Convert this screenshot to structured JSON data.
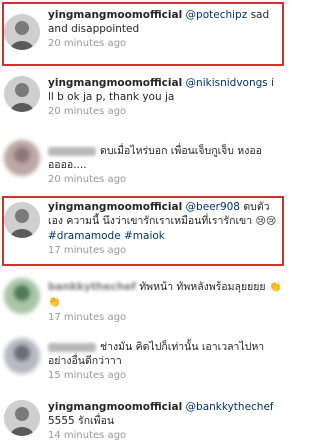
{
  "comments": [
    {
      "username": "yingmangmoomofficial",
      "mention": "@potechipz",
      "text": " sad and disappointed",
      "time": "20 minutes ago"
    },
    {
      "username": "yingmangmoomofficial",
      "mention": "@nikisnidvongs",
      "text": " i ll b ok ja p, thank you ja",
      "time": "20 minutes ago"
    },
    {
      "username": "",
      "mention": "",
      "text": "ดบเมื่อไหร่บอก เพื่อนเจ็บกูเจ็บ หงออ ออออ....",
      "time": "20 minutes ago"
    },
    {
      "username": "yingmangmoomofficial",
      "mention": "@beer908",
      "text": " ดบตัวเอง ความนี้ นึงว่าเขารักเราเหมือนที่เรารักเขา",
      "emoji": "😢😢",
      "hashtag1": "#dramamode",
      "hashtag2": "#maiok",
      "time": "17 minutes ago"
    },
    {
      "username": "bankkythechef",
      "mention": "",
      "text": "ทัพหน้า ทัพหลังพร้อมลุยยยย",
      "emoji": "👏👏",
      "time": "17 minutes ago"
    },
    {
      "username": "",
      "mention": "",
      "text": "ช่างมัน คิดไปก็เท่านั้น เอาเวลาไปหาอย่างอื่นดีกว่าาา",
      "time": "15 minutes ago"
    },
    {
      "username": "yingmangmoomofficial",
      "mention": "@bankkythechef",
      "text": " 5555 รักเพื่อน",
      "time": "14 minutes ago"
    }
  ],
  "colors": {
    "highlight": "#d32f2f",
    "mention": "#003569",
    "time": "#999999"
  }
}
